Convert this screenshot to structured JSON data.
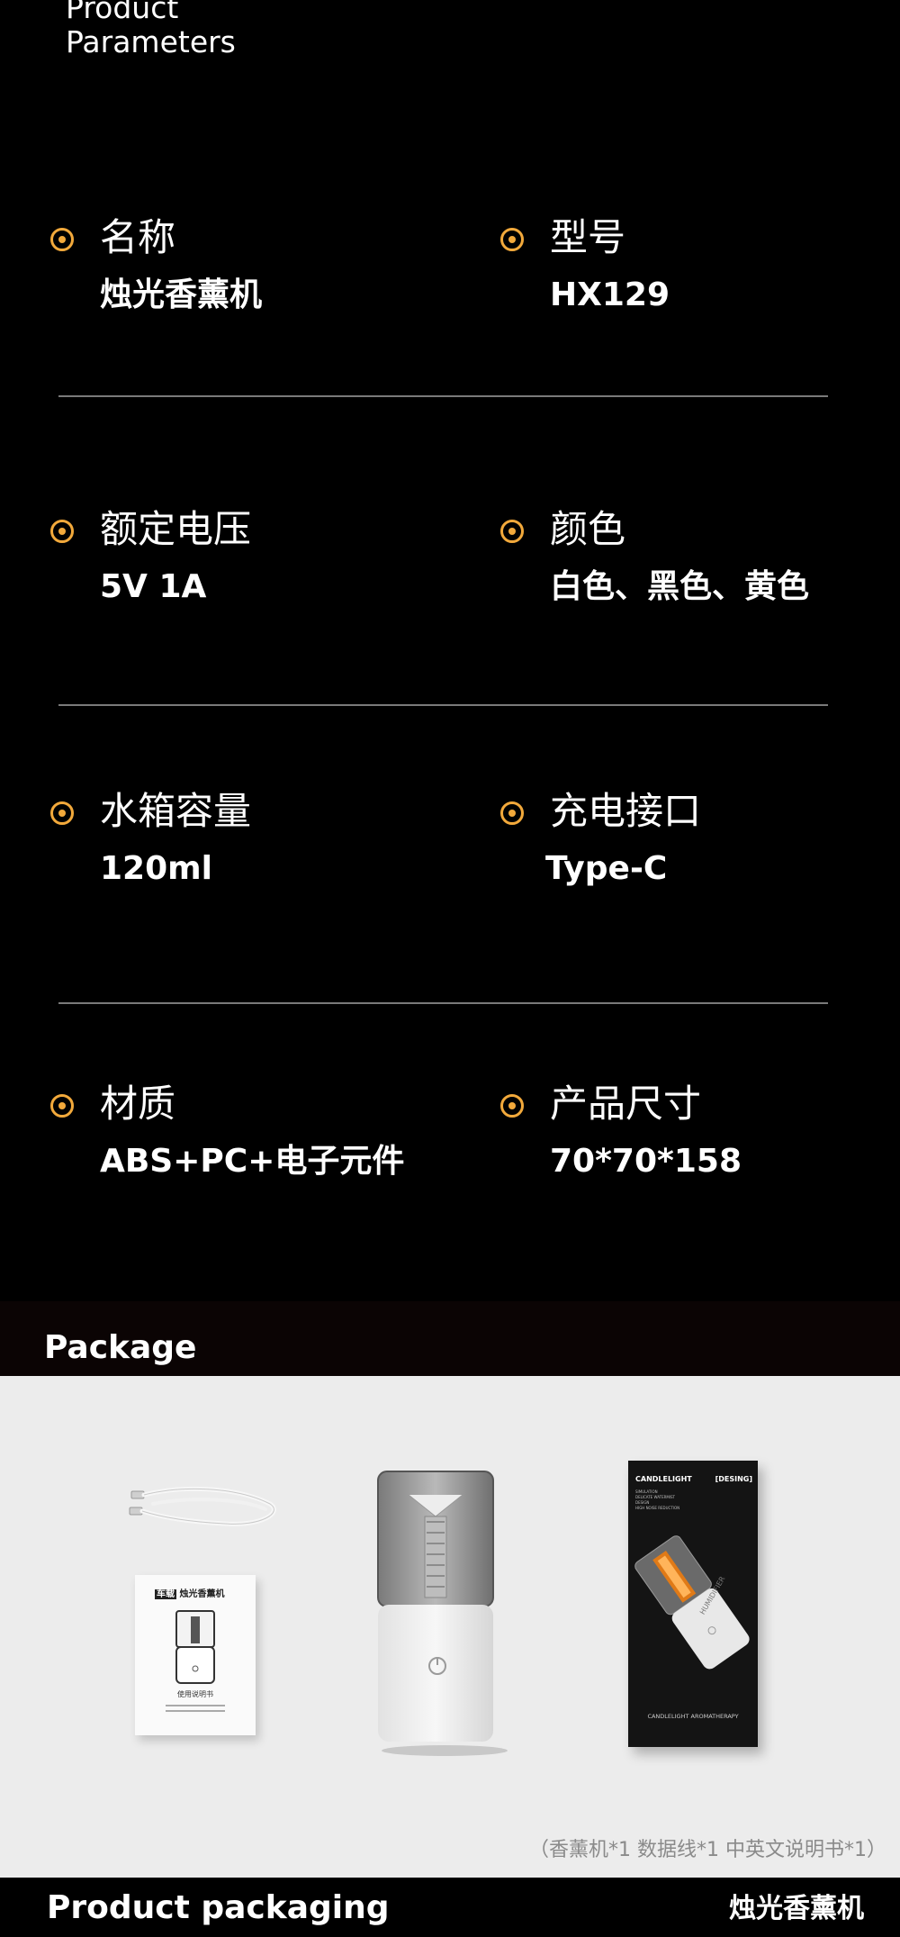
{
  "heading": {
    "line1": "Product",
    "line2": "Parameters"
  },
  "params": [
    {
      "label": "名称",
      "value": "烛光香薰机"
    },
    {
      "label": "型号",
      "value": "HX129"
    },
    {
      "label": "额定电压",
      "value": "5V  1A"
    },
    {
      "label": "颜色",
      "value": "白色、黑色、黄色"
    },
    {
      "label": "水箱容量",
      "value": "120ml"
    },
    {
      "label": "充电接口",
      "value": "Type-C"
    },
    {
      "label": "材质",
      "value": "ABS+PC+电子元件"
    },
    {
      "label": "产品尺寸",
      "value": "70*70*158"
    }
  ],
  "package": {
    "title": "Package",
    "contents_note": "（香薰机*1   数据线*1   中英文说明书*1）",
    "manual_brand": "车载",
    "manual_title": "烛光香薰机",
    "manual_caption": "使用说明书",
    "box_brand": "CANDLELIGHT",
    "box_tag": "[DESING]",
    "box_lines": [
      "SIMULATION",
      "DELICATE WATERMIST",
      "DESIGN",
      "HIGH NOISE REDUCTION"
    ],
    "box_footer": "CANDLELIGHT AROMATHERAPY",
    "box_side": "HUMIDIFIER"
  },
  "footer": {
    "left": "Product packaging",
    "right": "烛光香薰机"
  },
  "colors": {
    "accent": "#f2a93b",
    "background": "#000000",
    "divider": "#7a7a7a",
    "package_bg": "#ececec"
  }
}
